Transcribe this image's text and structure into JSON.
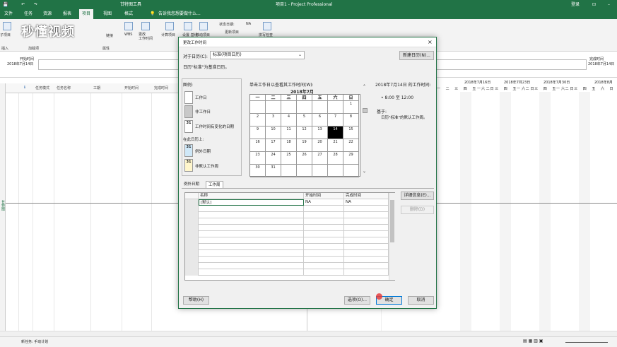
{
  "titlebar": {
    "context_tab": "甘特图工具",
    "title": "项目1 - Project Professional",
    "login": "登录"
  },
  "ribbon_tabs": [
    "文件",
    "任务",
    "资源",
    "报表",
    "项目",
    "视图",
    "格式"
  ],
  "search_placeholder": "告诉我您想要做什么...",
  "ribbon": {
    "sub_project": "子项目",
    "insert": "插入",
    "addins": "加载项",
    "link": "链接",
    "wbs": "WBS",
    "change_worktime": "更改\n工作时间",
    "calc_project": "计算项目",
    "set_baseline": "设置\n基线",
    "move_project": "移动项目",
    "status_date_label": "状态日期:",
    "status_date_value": "NA",
    "update_project": "更新项目",
    "spelling": "拼写检查",
    "properties": "属性",
    "proofing": "校对"
  },
  "watermark": "秒懂视频",
  "timeline": {
    "start_label": "开始时间",
    "start_date": "2018年7月14日",
    "end_label": "完成时间",
    "end_date": "2018年7月14日"
  },
  "side_label": "甘特图",
  "grid_headers": [
    "任务模式",
    "任务名称",
    "工期",
    "开始时间",
    "完成时间"
  ],
  "gantt_dates": [
    "2018年7月16日",
    "2018年7月23日",
    "2018年7月30日",
    "2018年8月"
  ],
  "gantt_days": "一 二 三 四 五 六 日",
  "status": {
    "new_tasks": "新任务: 手动计划"
  },
  "dialog": {
    "title": "更改工作时间",
    "for_calendar_label": "对于日历(C):",
    "calendar_value": "标准(项目日历)",
    "new_calendar_btn": "新建日历(N)...",
    "base_calendar_note": "日历\"标准\"为基准日历。",
    "legend_label": "图例:",
    "legend_working": "工作日",
    "legend_nonworking": "非工作日",
    "legend_edited": "工作时间有变化的日期",
    "legend_on_this": "在此日历上:",
    "legend_exception": "例外日期",
    "legend_nondefault": "非默认工作周",
    "legend_num": "31",
    "click_day_label": "单击工作日以查看其工作时间(W):",
    "month_title": "2018年7月",
    "weekdays": [
      "一",
      "二",
      "三",
      "四",
      "五",
      "六",
      "日"
    ],
    "days": [
      [
        "",
        "",
        "",
        "",
        "",
        "",
        "1"
      ],
      [
        "2",
        "3",
        "4",
        "5",
        "6",
        "7",
        "8"
      ],
      [
        "9",
        "10",
        "11",
        "12",
        "13",
        "14",
        "15"
      ],
      [
        "16",
        "17",
        "18",
        "19",
        "20",
        "21",
        "22"
      ],
      [
        "23",
        "24",
        "25",
        "26",
        "27",
        "28",
        "29"
      ],
      [
        "30",
        "31",
        "",
        "",
        "",
        "",
        ""
      ]
    ],
    "worktime_title": "2018年7月14日 的工作时间:",
    "worktime_value": "• 8:00 至 12:00",
    "based_on_label": "基于:",
    "based_on_value": "日历\"标准\"的默认工作周。",
    "tab_exceptions": "例外日期",
    "tab_workweeks": "工作周",
    "table_headers": [
      "名称",
      "开始时间",
      "完成时间"
    ],
    "table_rows": [
      [
        "[默认]",
        "NA",
        "NA"
      ]
    ],
    "details_btn": "详细信息(E)...",
    "delete_btn": "删除(D)",
    "help_btn": "帮助(H)",
    "options_btn": "选项(O)...",
    "ok_btn": "确定",
    "cancel_btn": "取消"
  }
}
